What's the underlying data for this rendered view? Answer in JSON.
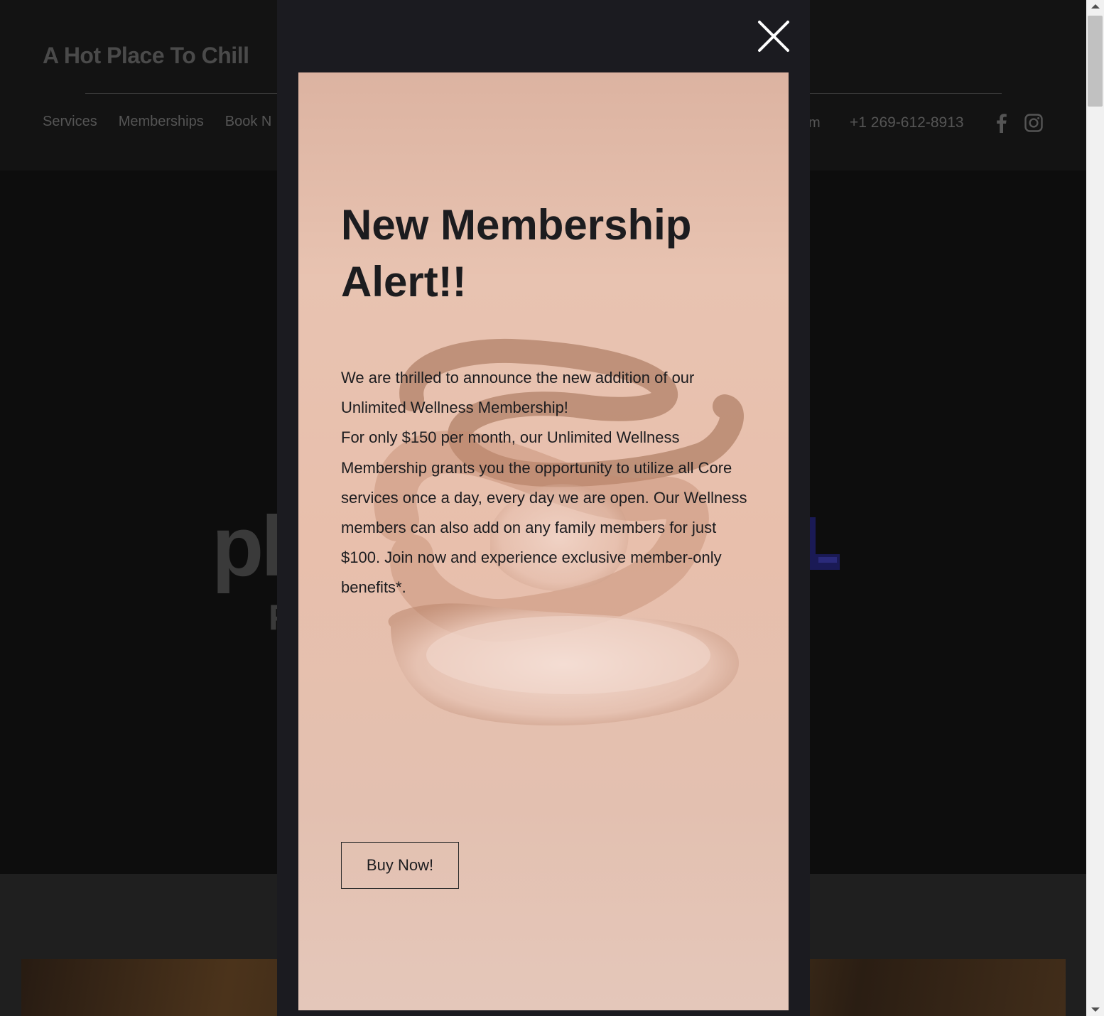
{
  "site": {
    "logo": "A Hot Place To Chill",
    "nav": [
      "Services",
      "Memberships",
      "Book N"
    ],
    "nav_partial_right": "m",
    "phone": "+1 269-612-8913",
    "social_icons": [
      "facebook-icon",
      "instagram-icon"
    ],
    "hero_heading_partial": "pl",
    "hero_sub_partial": "F"
  },
  "modal": {
    "close_icon": "close-icon",
    "title": "New Membership Alert!!",
    "body": [
      "We are thrilled to announce the new addition of our Unlimited Wellness Membership!",
      "For only $150 per month, our Unlimited Wellness Membership grants you the opportunity to utilize all Core services once a day, every day we are open. Our Wellness members can also add on any family members for just $100. Join now and experience exclusive member-only benefits*."
    ],
    "cta_label": "Buy Now!"
  },
  "colors": {
    "overlay": "#1b1b20",
    "card_peach": "#e8c3b1",
    "text_dark": "#1c1c1f",
    "close_icon": "#ffffff"
  }
}
